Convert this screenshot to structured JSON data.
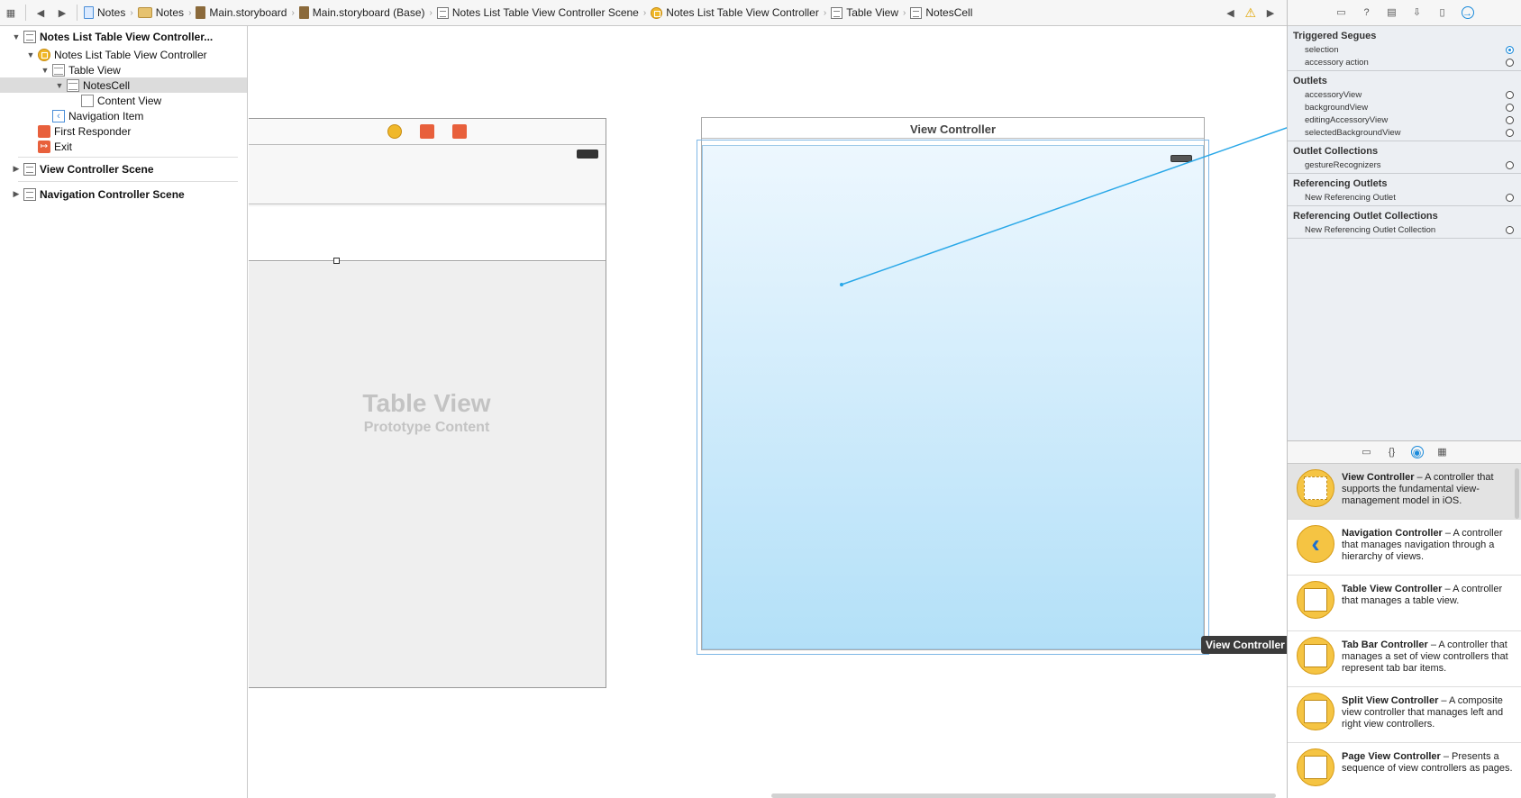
{
  "breadcrumbs": [
    {
      "label": "Notes",
      "icon": "project-file-icon"
    },
    {
      "label": "Notes",
      "icon": "folder-icon"
    },
    {
      "label": "Main.storyboard",
      "icon": "storyboard-icon"
    },
    {
      "label": "Main.storyboard (Base)",
      "icon": "storyboard-icon"
    },
    {
      "label": "Notes List Table View Controller Scene",
      "icon": "scene-icon"
    },
    {
      "label": "Notes List Table View Controller",
      "icon": "view-controller-icon"
    },
    {
      "label": "Table View",
      "icon": "table-view-icon"
    },
    {
      "label": "NotesCell",
      "icon": "table-cell-icon"
    }
  ],
  "outline": {
    "scene_title": "Notes List Table View Controller...",
    "controller": "Notes List Table View Controller",
    "table_view": "Table View",
    "cell": "NotesCell",
    "content_view": "Content View",
    "nav_item": "Navigation Item",
    "first_responder": "First Responder",
    "exit": "Exit",
    "vc_scene": "View Controller Scene",
    "nav_scene": "Navigation Controller Scene"
  },
  "canvas": {
    "tv_title": "Table View",
    "tv_subtitle": "Prototype Content",
    "vc_header": "View Controller",
    "tooltip": "View Controller"
  },
  "inspector": {
    "triggered_segues": {
      "title": "Triggered Segues",
      "items": [
        "selection",
        "accessory action"
      ]
    },
    "outlets": {
      "title": "Outlets",
      "items": [
        "accessoryView",
        "backgroundView",
        "editingAccessoryView",
        "selectedBackgroundView"
      ]
    },
    "outlet_collections": {
      "title": "Outlet Collections",
      "items": [
        "gestureRecognizers"
      ]
    },
    "referencing_outlets": {
      "title": "Referencing Outlets",
      "items": [
        "New Referencing Outlet"
      ]
    },
    "referencing_outlet_collections": {
      "title": "Referencing Outlet Collections",
      "items": [
        "New Referencing Outlet Collection"
      ]
    }
  },
  "library": [
    {
      "name": "View Controller",
      "desc": " – A controller that supports the fundamental view-management model in iOS."
    },
    {
      "name": "Navigation Controller",
      "desc": " – A controller that manages navigation through a hierarchy of views."
    },
    {
      "name": "Table View Controller",
      "desc": " – A controller that manages a table view."
    },
    {
      "name": "Tab Bar Controller",
      "desc": " – A controller that manages a set of view controllers that represent tab bar items."
    },
    {
      "name": "Split View Controller",
      "desc": " – A composite view controller that manages left and right view controllers."
    },
    {
      "name": "Page View Controller",
      "desc": " – Presents a sequence of view controllers as pages."
    }
  ],
  "colors": {
    "accent": "#1c8bdb",
    "connection_line": "#2aa8e8",
    "vc_icon": "#f0b82a",
    "exit_icon": "#e8603c"
  }
}
